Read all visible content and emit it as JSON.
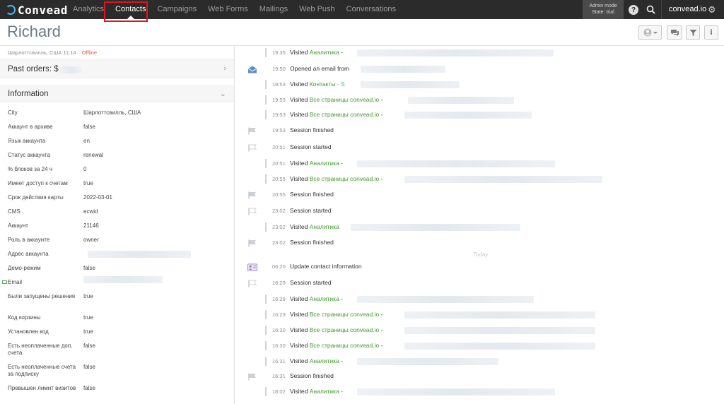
{
  "topbar": {
    "logo": "Convead",
    "nav": [
      "Analytics",
      "Contacts",
      "Campaigns",
      "Web Forms",
      "Mailings",
      "Web Push",
      "Conversations"
    ],
    "admin_mode": "Admin mode",
    "admin_state": "State: trial",
    "site": "convead.io",
    "icons": [
      "help-icon",
      "search-icon",
      "gear-icon"
    ]
  },
  "contact": {
    "name": "Richard",
    "location": "Шарлоттсвилль, США 11:14",
    "status": "Offline",
    "past_orders": "Past orders: $",
    "information": "Information"
  },
  "properties": [
    {
      "k": "City",
      "v": "Шарлоттсвилль, США"
    },
    {
      "k": "Аккаунт в архиве",
      "v": "false"
    },
    {
      "k": "Язык аккаунта",
      "v": "en"
    },
    {
      "k": "Статус аккаунта",
      "v": "renewal"
    },
    {
      "k": "% блоков за 24 ч",
      "v": "0"
    },
    {
      "k": "Имеет доступ к счетам",
      "v": "true"
    },
    {
      "k": "Срок действия карты",
      "v": "2022-03-01"
    },
    {
      "k": "CMS",
      "v": "ecwid"
    },
    {
      "k": "Аккаунт",
      "v": "21146"
    },
    {
      "k": "Роль в аккаунте",
      "v": "owner"
    },
    {
      "k": "Адрес аккаунта",
      "v": ""
    },
    {
      "k": "Демо-режим",
      "v": "false"
    },
    {
      "k": "Email",
      "v": ""
    },
    {
      "k": "Были запущены решения",
      "v": "true"
    },
    {
      "k": "Код корзины",
      "v": "true"
    },
    {
      "k": "Установлен код",
      "v": "true"
    },
    {
      "k": "Есть неоплаченные доп. счета",
      "v": "false"
    },
    {
      "k": "Есть неоплаченные счета за подписку",
      "v": "false"
    },
    {
      "k": "Превышен лимит визитов",
      "v": "false"
    }
  ],
  "events": [
    {
      "time": "19:35",
      "text": "Visited ",
      "link": "Аналитика",
      "suffix": " -",
      "icon": ""
    },
    {
      "time": "19:50",
      "text": "Opened an email from",
      "link": "",
      "suffix": "",
      "icon": "envelope-icon"
    },
    {
      "time": "19:53",
      "text": "Visited ",
      "link": "Контакты",
      "suffix": " - S",
      "icon": ""
    },
    {
      "time": "19:53",
      "text": "Visited ",
      "link": "Все страницы convead.io",
      "suffix": " - ",
      "icon": ""
    },
    {
      "time": "19:53",
      "text": "Visited ",
      "link": "Все страницы convead.io",
      "suffix": " -",
      "icon": ""
    },
    {
      "time": "19:53",
      "text": "Session finished",
      "link": "",
      "suffix": "",
      "icon": "flag-filled-icon"
    },
    {
      "time": "20:51",
      "text": "Session started",
      "link": "",
      "suffix": "",
      "icon": "flag-outline-icon"
    },
    {
      "time": "20:51",
      "text": "Visited ",
      "link": "Аналитика",
      "suffix": " -",
      "icon": ""
    },
    {
      "time": "20:55",
      "text": "Visited ",
      "link": "Все страницы convead.io",
      "suffix": " -",
      "icon": ""
    },
    {
      "time": "20:55",
      "text": "Session finished",
      "link": "",
      "suffix": "",
      "icon": "flag-filled-icon"
    },
    {
      "time": "23:02",
      "text": "Session started",
      "link": "",
      "suffix": "",
      "icon": "flag-outline-icon"
    },
    {
      "time": "23:02",
      "text": "Visited ",
      "link": "Аналитика",
      "suffix": "",
      "icon": ""
    },
    {
      "time": "23:02",
      "text": "Session finished",
      "link": "",
      "suffix": "",
      "icon": "flag-filled-icon"
    },
    {
      "time": "06:20",
      "text": "Update contact information",
      "link": "",
      "suffix": "",
      "icon": "contact-card-icon"
    },
    {
      "time": "16:29",
      "text": "Session started",
      "link": "",
      "suffix": "",
      "icon": "flag-outline-icon"
    },
    {
      "time": "16:29",
      "text": "Visited ",
      "link": "Аналитика",
      "suffix": " -",
      "icon": ""
    },
    {
      "time": "16:29",
      "text": "Visited ",
      "link": "Все страницы convead.io",
      "suffix": " -",
      "icon": ""
    },
    {
      "time": "16:30",
      "text": "Visited ",
      "link": "Все страницы convead.io",
      "suffix": " -",
      "icon": ""
    },
    {
      "time": "16:30",
      "text": "Visited ",
      "link": "Все страницы convead.io",
      "suffix": " -",
      "icon": ""
    },
    {
      "time": "16:31",
      "text": "Visited ",
      "link": "Аналитика",
      "suffix": " -",
      "icon": ""
    },
    {
      "time": "16:31",
      "text": "Session finished",
      "link": "",
      "suffix": "",
      "icon": "flag-filled-icon"
    },
    {
      "time": "18:02",
      "text": "Visited ",
      "link": "Аналитика",
      "suffix": " -",
      "icon": ""
    }
  ],
  "today_label": "Today",
  "colors": {
    "link_green": "#3f9a2d",
    "offline_red": "#e05a4c",
    "highlight_red": "#e0151b",
    "nav_bg": "#2b2b2b"
  }
}
